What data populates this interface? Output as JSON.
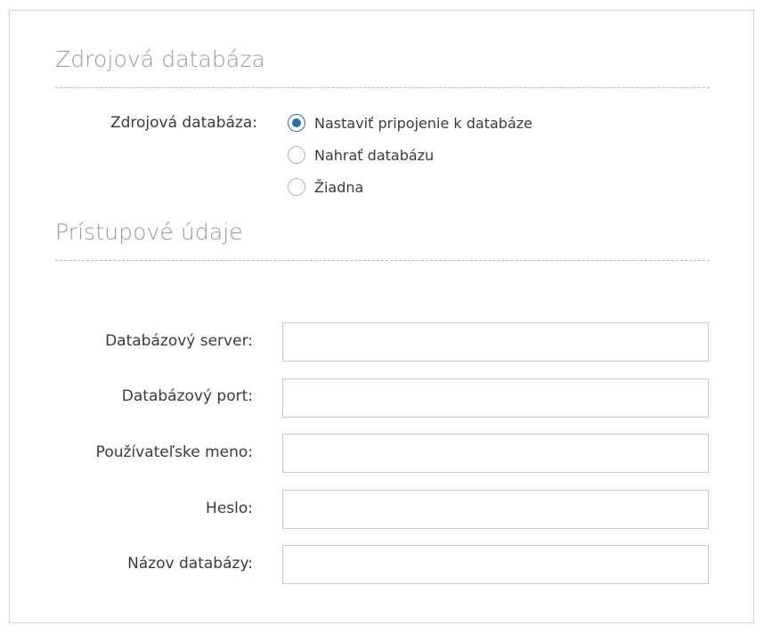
{
  "source_section": {
    "title": "Zdrojová databáza",
    "label": "Zdrojová databáza:",
    "options": [
      {
        "label": "Nastaviť pripojenie k databáze",
        "checked": true
      },
      {
        "label": "Nahrať databázu",
        "checked": false
      },
      {
        "label": "Žiadna",
        "checked": false
      }
    ]
  },
  "access_section": {
    "title": "Prístupové údaje",
    "fields": [
      {
        "label": "Databázový server:",
        "value": ""
      },
      {
        "label": "Databázový port:",
        "value": ""
      },
      {
        "label": "Používateľske meno:",
        "value": ""
      },
      {
        "label": "Heslo:",
        "value": ""
      },
      {
        "label": "Názov databázy:",
        "value": ""
      }
    ]
  },
  "colors": {
    "accent": "#2a6fae",
    "section_title": "#9a9a9a",
    "text": "#3b3b3b",
    "border": "#c9c9c9"
  }
}
